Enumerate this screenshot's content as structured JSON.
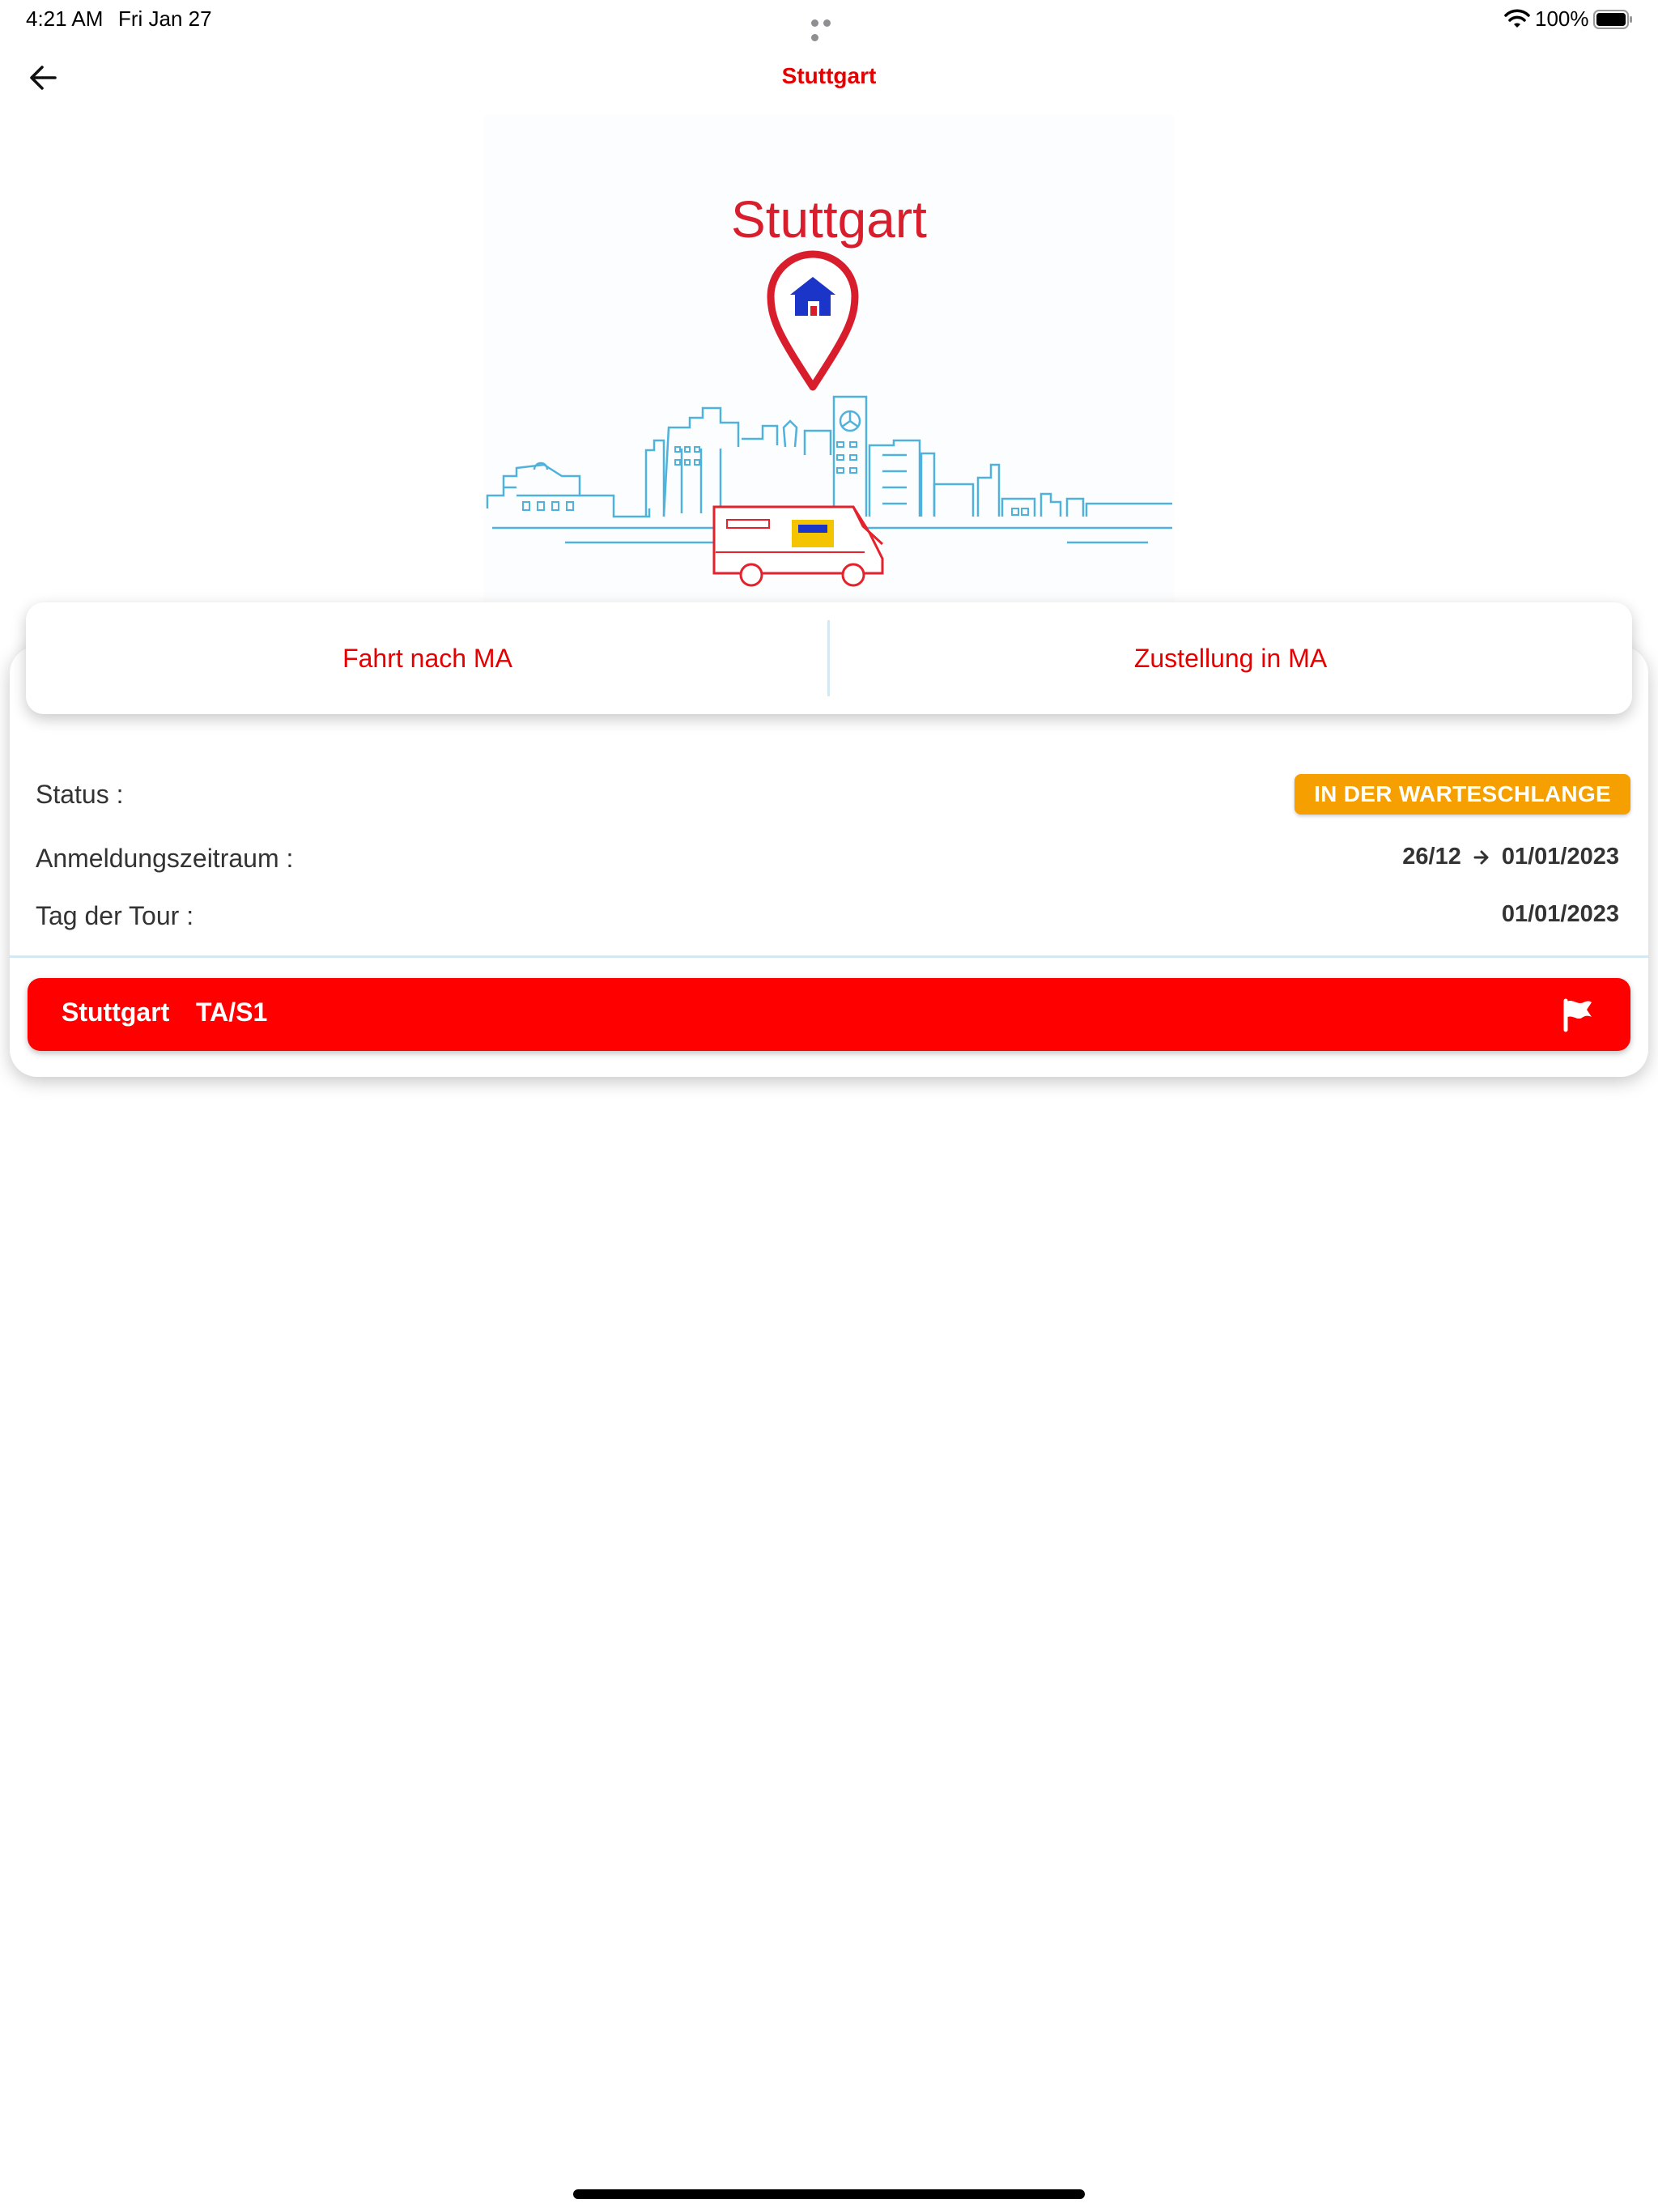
{
  "status_bar": {
    "time": "4:21 AM",
    "date": "Fri Jan 27",
    "battery": "100%"
  },
  "nav": {
    "title": "Stuttgart",
    "back_icon": "arrow-left-icon"
  },
  "hero": {
    "title": "Stuttgart",
    "pin_icon": "location-home-pin-icon"
  },
  "tabs": [
    {
      "label": "Fahrt nach MA"
    },
    {
      "label": "Zustellung in MA"
    }
  ],
  "info": {
    "status_label": "Status :",
    "status_value": "IN DER WARTESCHLANGE",
    "period_label": "Anmeldungszeitraum :",
    "period_from": "26/12",
    "period_to": "01/01/2023",
    "day_label": "Tag der Tour :",
    "day_value": "01/01/2023"
  },
  "tour": {
    "city": "Stuttgart",
    "code": "TA/S1",
    "icon": "flag-icon"
  },
  "colors": {
    "accent": "#e60000",
    "button": "#ff0000",
    "badge": "#f5a000",
    "divider": "#d4e8f2"
  }
}
